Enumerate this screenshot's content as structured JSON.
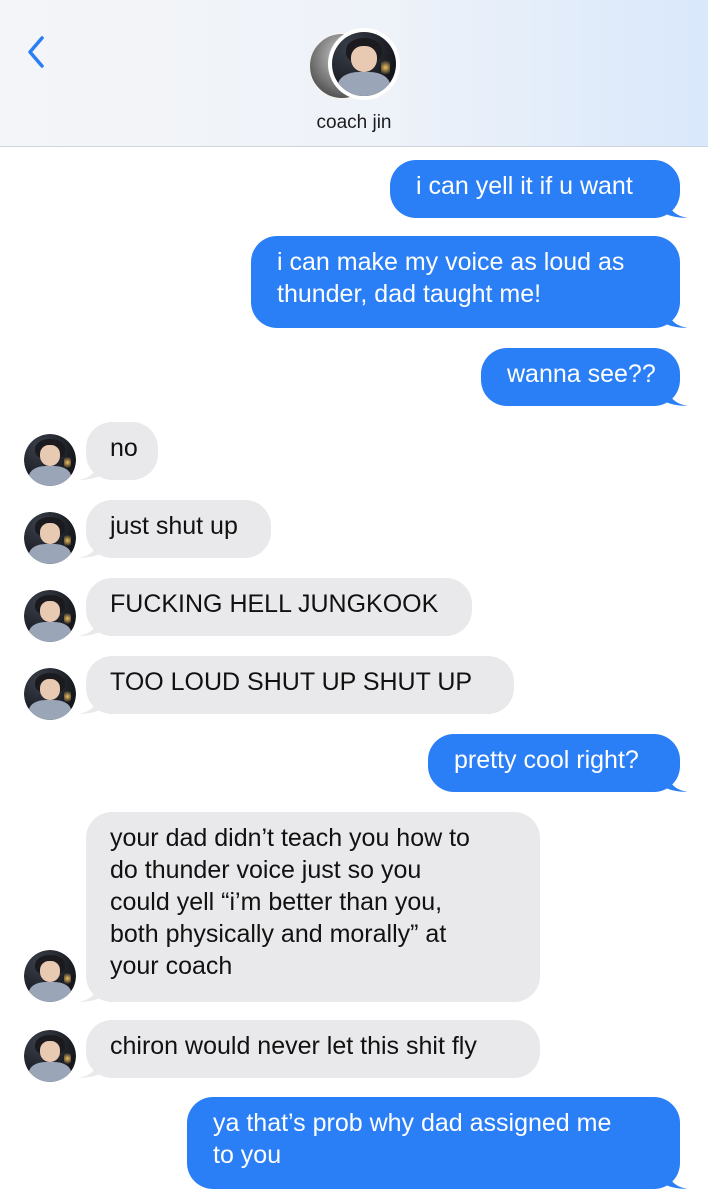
{
  "header": {
    "back_icon": "chevron-left-icon",
    "contact_name": "coach jin",
    "accent_color": "#2b7ff6"
  },
  "messages": [
    {
      "from": "me",
      "lines": [
        "i can yell it if u want"
      ]
    },
    {
      "from": "me",
      "lines": [
        "i can make my voice as loud as",
        "thunder, dad taught me!"
      ]
    },
    {
      "from": "me",
      "lines": [
        "wanna see??"
      ]
    },
    {
      "from": "them",
      "lines": [
        "no"
      ]
    },
    {
      "from": "them",
      "lines": [
        "just shut up"
      ]
    },
    {
      "from": "them",
      "lines": [
        "FUCKING HELL JUNGKOOK"
      ]
    },
    {
      "from": "them",
      "lines": [
        "TOO LOUD SHUT UP SHUT UP"
      ]
    },
    {
      "from": "me",
      "lines": [
        "pretty cool right?"
      ]
    },
    {
      "from": "them",
      "lines": [
        "your dad didn’t teach you how to",
        "do thunder voice just so you",
        "could yell “i’m better than you,",
        "both physically and morally” at",
        "your coach"
      ]
    },
    {
      "from": "them",
      "lines": [
        "chiron would never let this shit fly"
      ]
    },
    {
      "from": "me",
      "lines": [
        "ya that’s prob why dad assigned me",
        "to you"
      ]
    }
  ]
}
